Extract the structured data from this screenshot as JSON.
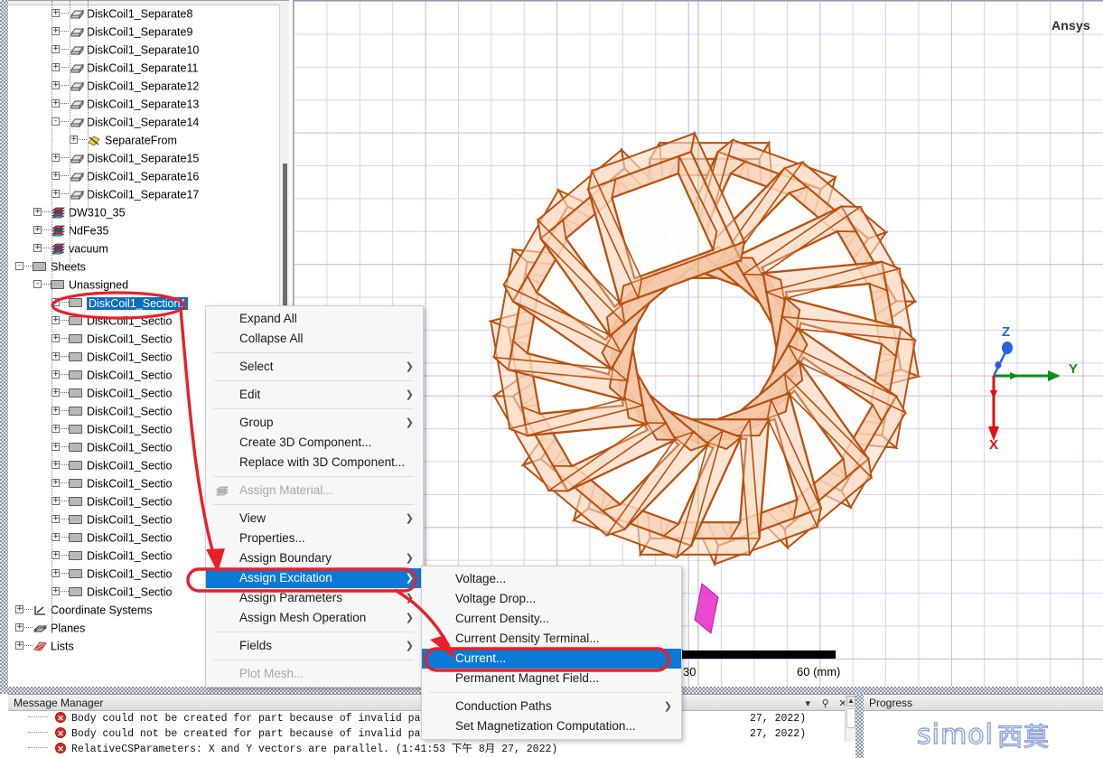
{
  "tree": {
    "rows": [
      {
        "label": "DiskCoil1_Separate8",
        "icon": "solid-icon",
        "depth": 3,
        "expander": "+"
      },
      {
        "label": "DiskCoil1_Separate9",
        "icon": "solid-icon",
        "depth": 3,
        "expander": "+"
      },
      {
        "label": "DiskCoil1_Separate10",
        "icon": "solid-icon",
        "depth": 3,
        "expander": "+"
      },
      {
        "label": "DiskCoil1_Separate11",
        "icon": "solid-icon",
        "depth": 3,
        "expander": "+"
      },
      {
        "label": "DiskCoil1_Separate12",
        "icon": "solid-icon",
        "depth": 3,
        "expander": "+"
      },
      {
        "label": "DiskCoil1_Separate13",
        "icon": "solid-icon",
        "depth": 3,
        "expander": "+"
      },
      {
        "label": "DiskCoil1_Separate14",
        "icon": "solid-icon",
        "depth": 3,
        "expander": "-"
      },
      {
        "label": "SeparateFrom",
        "icon": "separate-operation-icon",
        "depth": 4,
        "expander": "+"
      },
      {
        "label": "DiskCoil1_Separate15",
        "icon": "solid-icon",
        "depth": 3,
        "expander": "+"
      },
      {
        "label": "DiskCoil1_Separate16",
        "icon": "solid-icon",
        "depth": 3,
        "expander": "+"
      },
      {
        "label": "DiskCoil1_Separate17",
        "icon": "solid-icon",
        "depth": 3,
        "expander": "+"
      },
      {
        "label": "DW310_35",
        "icon": "material-icon",
        "depth": 2,
        "expander": "+"
      },
      {
        "label": "NdFe35",
        "icon": "material-icon",
        "depth": 2,
        "expander": "+"
      },
      {
        "label": "vacuum",
        "icon": "material-icon",
        "depth": 2,
        "expander": "+"
      },
      {
        "label": "Sheets",
        "icon": "sheet-icon",
        "depth": 1,
        "expander": "-"
      },
      {
        "label": "Unassigned",
        "icon": "sheet-icon",
        "depth": 2,
        "expander": "-"
      },
      {
        "label": "DiskCoil1_Section1",
        "icon": "sheet-icon",
        "depth": 3,
        "expander": "+",
        "selected": true
      },
      {
        "label": "DiskCoil1_Sectio",
        "icon": "sheet-icon",
        "depth": 3,
        "expander": "+"
      },
      {
        "label": "DiskCoil1_Sectio",
        "icon": "sheet-icon",
        "depth": 3,
        "expander": "+"
      },
      {
        "label": "DiskCoil1_Sectio",
        "icon": "sheet-icon",
        "depth": 3,
        "expander": "+"
      },
      {
        "label": "DiskCoil1_Sectio",
        "icon": "sheet-icon",
        "depth": 3,
        "expander": "+"
      },
      {
        "label": "DiskCoil1_Sectio",
        "icon": "sheet-icon",
        "depth": 3,
        "expander": "+"
      },
      {
        "label": "DiskCoil1_Sectio",
        "icon": "sheet-icon",
        "depth": 3,
        "expander": "+"
      },
      {
        "label": "DiskCoil1_Sectio",
        "icon": "sheet-icon",
        "depth": 3,
        "expander": "+"
      },
      {
        "label": "DiskCoil1_Sectio",
        "icon": "sheet-icon",
        "depth": 3,
        "expander": "+"
      },
      {
        "label": "DiskCoil1_Sectio",
        "icon": "sheet-icon",
        "depth": 3,
        "expander": "+"
      },
      {
        "label": "DiskCoil1_Sectio",
        "icon": "sheet-icon",
        "depth": 3,
        "expander": "+"
      },
      {
        "label": "DiskCoil1_Sectio",
        "icon": "sheet-icon",
        "depth": 3,
        "expander": "+"
      },
      {
        "label": "DiskCoil1_Sectio",
        "icon": "sheet-icon",
        "depth": 3,
        "expander": "+"
      },
      {
        "label": "DiskCoil1_Sectio",
        "icon": "sheet-icon",
        "depth": 3,
        "expander": "+"
      },
      {
        "label": "DiskCoil1_Sectio",
        "icon": "sheet-icon",
        "depth": 3,
        "expander": "+"
      },
      {
        "label": "DiskCoil1_Sectio",
        "icon": "sheet-icon",
        "depth": 3,
        "expander": "+"
      },
      {
        "label": "DiskCoil1_Sectio",
        "icon": "sheet-icon",
        "depth": 3,
        "expander": "+"
      },
      {
        "label": "Coordinate Systems",
        "icon": "coordinate-systems-icon",
        "depth": 1,
        "expander": "+"
      },
      {
        "label": "Planes",
        "icon": "planes-icon",
        "depth": 1,
        "expander": "+"
      },
      {
        "label": "Lists",
        "icon": "lists-icon",
        "depth": 1,
        "expander": "+"
      }
    ]
  },
  "viewport": {
    "brand": "Ansys",
    "axes": {
      "x": "X",
      "y": "Y",
      "z": "Z"
    },
    "scale": {
      "left_tick": "30",
      "right_tick": "60 (mm)"
    },
    "colors": {
      "geometry_line": "#b8500f",
      "geometry_fill": "#fbdcc6",
      "grid": "#c8c8e6"
    }
  },
  "context_menu": {
    "items": [
      {
        "label": "Expand All",
        "submenu": false,
        "state": "normal"
      },
      {
        "label": "Collapse All",
        "submenu": false,
        "state": "normal"
      },
      {
        "sep": true
      },
      {
        "label": "Select",
        "submenu": true,
        "state": "normal"
      },
      {
        "sep": true
      },
      {
        "label": "Edit",
        "submenu": true,
        "state": "normal"
      },
      {
        "sep": true
      },
      {
        "label": "Group",
        "submenu": true,
        "state": "normal"
      },
      {
        "label": "Create 3D Component...",
        "submenu": false,
        "state": "normal"
      },
      {
        "label": "Replace with 3D Component...",
        "submenu": false,
        "state": "normal"
      },
      {
        "sep": true
      },
      {
        "label": "Assign Material...",
        "submenu": false,
        "state": "disabled"
      },
      {
        "sep": true
      },
      {
        "label": "View",
        "submenu": true,
        "state": "normal"
      },
      {
        "label": "Properties...",
        "submenu": false,
        "state": "normal"
      },
      {
        "label": "Assign Boundary",
        "submenu": true,
        "state": "normal"
      },
      {
        "label": "Assign Excitation",
        "submenu": true,
        "state": "highlighted"
      },
      {
        "label": "Assign Parameters",
        "submenu": true,
        "state": "normal"
      },
      {
        "label": "Assign Mesh Operation",
        "submenu": true,
        "state": "normal"
      },
      {
        "sep": true
      },
      {
        "label": "Fields",
        "submenu": true,
        "state": "normal"
      },
      {
        "sep": true
      },
      {
        "label": "Plot Mesh...",
        "submenu": false,
        "state": "disabled"
      }
    ]
  },
  "submenu": {
    "items": [
      {
        "label": "Voltage...",
        "submenu": false,
        "state": "normal"
      },
      {
        "label": "Voltage Drop...",
        "submenu": false,
        "state": "normal"
      },
      {
        "label": "Current Density...",
        "submenu": false,
        "state": "normal"
      },
      {
        "label": "Current Density Terminal...",
        "submenu": false,
        "state": "normal"
      },
      {
        "label": "Current...",
        "submenu": false,
        "state": "highlighted"
      },
      {
        "label": "Permanent Magnet Field...",
        "submenu": false,
        "state": "normal"
      },
      {
        "sep": true
      },
      {
        "label": "Conduction Paths",
        "submenu": true,
        "state": "normal"
      },
      {
        "label": "Set Magnetization Computation...",
        "submenu": false,
        "state": "normal"
      }
    ]
  },
  "message_manager": {
    "title": "Message Manager",
    "window_buttons": [
      "▾",
      "⚲",
      "✕"
    ],
    "rows": [
      {
        "severity": "error",
        "text": "Body could not be created for part because of invalid parame",
        "tail": "  27,  2022)"
      },
      {
        "severity": "error",
        "text": "Body could not be created for part because of invalid parame",
        "tail": "  27,  2022)"
      },
      {
        "severity": "error",
        "text": "RelativeCSParameters: X and Y vectors are parallel. (1:41:53 下午  8月 27, 2022)",
        "tail": ""
      }
    ]
  },
  "progress": {
    "title": "Progress",
    "watermark_latin": "simol",
    "watermark_cjk": "西莫"
  },
  "annotations": {
    "accent_color": "#e8202a",
    "marks": [
      "ellipse-around-selected-node",
      "arrow-to-assign-excitation",
      "ellipse-around-assign-excitation",
      "arrow-to-current",
      "ellipse-around-current"
    ]
  }
}
